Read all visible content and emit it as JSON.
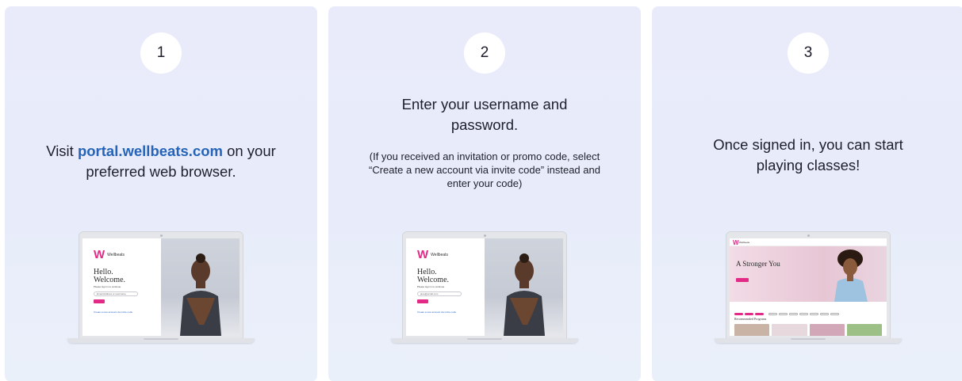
{
  "steps": [
    {
      "number": "1",
      "title_prefix": "Visit ",
      "title_link": "portal.wellbeats.com",
      "title_suffix": " on your preferred web browser.",
      "screen": {
        "brand": "Wellbeats",
        "hello": "Hello.",
        "welcome": "Welcome.",
        "subtitle": "Please sign in to continue.",
        "field": "Email Address or username",
        "link": "Create a new account via invite code"
      }
    },
    {
      "number": "2",
      "title": "Enter your username and password.",
      "note": "(If you received an invitation or promo code, select  “Create a new account via invite code” instead and enter your code)",
      "screen": {
        "brand": "Wellbeats",
        "hello": "Hello.",
        "welcome": "Welcome.",
        "subtitle": "Please sign in to continue.",
        "field": "jane@email.com",
        "link": "Create a new account via invite code"
      }
    },
    {
      "number": "3",
      "title": "Once signed in, you can start playing classes!",
      "screen": {
        "brand": "Wellbeats",
        "hero": "A Stronger You",
        "section": "Recommended Programs"
      }
    }
  ],
  "colors": {
    "link": "#2564b8",
    "brand_pink": "#e32a86",
    "card_bg": "#e9ebfb"
  }
}
